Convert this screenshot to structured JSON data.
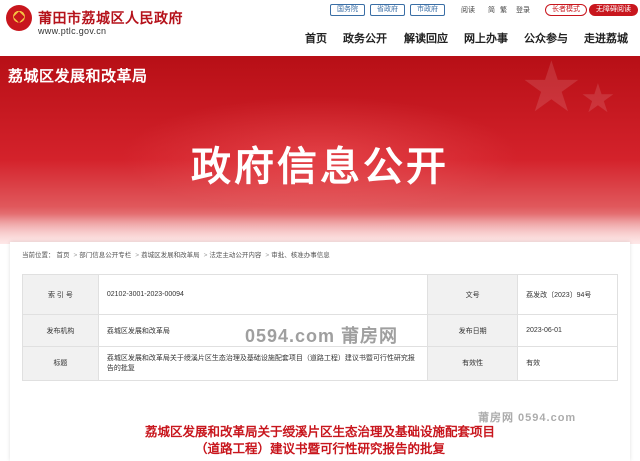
{
  "header": {
    "site_title": "莆田市荔城区人民政府",
    "site_url": "www.ptlc.gov.cn",
    "top_links": [
      "国务院",
      "省政府",
      "市政府"
    ],
    "utility_links": [
      "阅读",
      "简",
      "繁",
      "登录"
    ],
    "elder_mode": "长者模式",
    "access_mode": "无障碍阅读",
    "nav": [
      "首页",
      "政务公开",
      "解读回应",
      "网上办事",
      "公众参与",
      "走进荔城"
    ]
  },
  "banner": {
    "dept_name": "荔城区发展和改革局",
    "title": "政府信息公开"
  },
  "breadcrumb": {
    "prefix": "当前位置：",
    "items": [
      "首页",
      "部门信息公开专栏",
      "荔城区发展和改革局",
      "法定主动公开内容",
      "审批、核准办事信息"
    ]
  },
  "meta_table": {
    "index_label": "索 引 号",
    "index_value": "02102-3001-2023-00094",
    "docno_label": "文号",
    "docno_value": "荔发改〔2023〕94号",
    "org_label": "发布机构",
    "org_value": "荔城区发展和改革局",
    "date_label": "发布日期",
    "date_value": "2023-06-01",
    "title_label": "标题",
    "title_value": "荔城区发展和改革局关于绶溪片区生态治理及基础设施配套项目（道路工程）建议书暨可行性研究报告的批复",
    "valid_label": "有效性",
    "valid_value": "有效"
  },
  "document": {
    "title_line1": "荔城区发展和改革局关于绶溪片区生态治理及基础设施配套项目",
    "title_line2": "（道路工程）建议书暨可行性研究报告的批复"
  },
  "watermarks": {
    "main": "0594.com 莆房网",
    "small": "莆房网 0594.com"
  },
  "colors": {
    "brand_red": "#c8161d",
    "link_blue": "#3a6ea5"
  }
}
